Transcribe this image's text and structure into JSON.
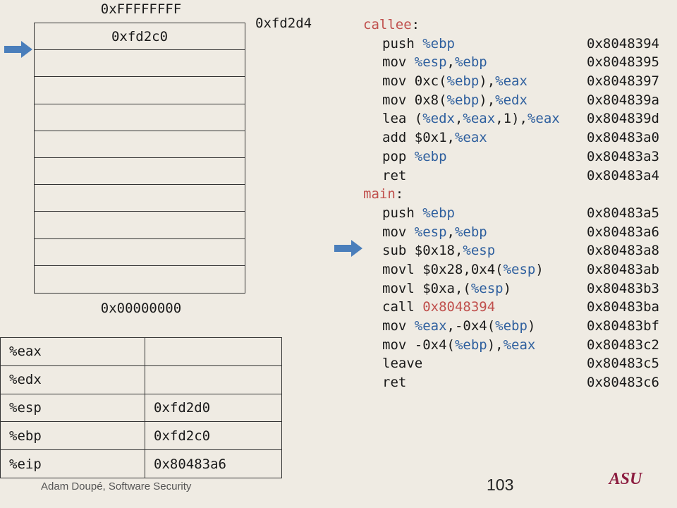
{
  "stack": {
    "top_address": "0xFFFFFFFF",
    "bottom_address": "0x00000000",
    "sp_annotation": "0xfd2d4",
    "slots": [
      "0xfd2c0",
      "",
      "",
      "",
      "",
      "",
      "",
      "",
      "",
      ""
    ]
  },
  "registers": [
    {
      "name": "%eax",
      "value": ""
    },
    {
      "name": "%edx",
      "value": ""
    },
    {
      "name": "%esp",
      "value": "0xfd2d0"
    },
    {
      "name": "%ebp",
      "value": "0xfd2c0"
    },
    {
      "name": "%eip",
      "value": "0x80483a6"
    }
  ],
  "code": {
    "callee_label": "callee",
    "main_label": "main",
    "colon": ":",
    "callee_lines": [
      {
        "parts": [
          {
            "t": "push ",
            "c": "op"
          },
          {
            "t": "%ebp",
            "c": "reg"
          }
        ],
        "addr": "0x8048394"
      },
      {
        "parts": [
          {
            "t": "mov ",
            "c": "op"
          },
          {
            "t": "%esp",
            "c": "reg"
          },
          {
            "t": ",",
            "c": "op"
          },
          {
            "t": "%ebp",
            "c": "reg"
          }
        ],
        "addr": "0x8048395"
      },
      {
        "parts": [
          {
            "t": "mov 0xc(",
            "c": "op"
          },
          {
            "t": "%ebp",
            "c": "reg"
          },
          {
            "t": "),",
            "c": "op"
          },
          {
            "t": "%eax",
            "c": "reg"
          }
        ],
        "addr": "0x8048397"
      },
      {
        "parts": [
          {
            "t": "mov 0x8(",
            "c": "op"
          },
          {
            "t": "%ebp",
            "c": "reg"
          },
          {
            "t": "),",
            "c": "op"
          },
          {
            "t": "%edx",
            "c": "reg"
          }
        ],
        "addr": "0x804839a"
      },
      {
        "parts": [
          {
            "t": "lea (",
            "c": "op"
          },
          {
            "t": "%edx",
            "c": "reg"
          },
          {
            "t": ",",
            "c": "op"
          },
          {
            "t": "%eax",
            "c": "reg"
          },
          {
            "t": ",1),",
            "c": "op"
          },
          {
            "t": "%eax",
            "c": "reg"
          }
        ],
        "addr": "0x804839d"
      },
      {
        "parts": [
          {
            "t": "add $0x1,",
            "c": "op"
          },
          {
            "t": "%eax",
            "c": "reg"
          }
        ],
        "addr": "0x80483a0"
      },
      {
        "parts": [
          {
            "t": "pop ",
            "c": "op"
          },
          {
            "t": "%ebp",
            "c": "reg"
          }
        ],
        "addr": "0x80483a3"
      },
      {
        "parts": [
          {
            "t": "ret",
            "c": "op"
          }
        ],
        "addr": "0x80483a4"
      }
    ],
    "main_lines": [
      {
        "parts": [
          {
            "t": "push ",
            "c": "op"
          },
          {
            "t": "%ebp",
            "c": "reg"
          }
        ],
        "addr": "0x80483a5"
      },
      {
        "parts": [
          {
            "t": "mov ",
            "c": "op"
          },
          {
            "t": "%esp",
            "c": "reg"
          },
          {
            "t": ",",
            "c": "op"
          },
          {
            "t": "%ebp",
            "c": "reg"
          }
        ],
        "addr": "0x80483a6"
      },
      {
        "parts": [
          {
            "t": "sub $0x18,",
            "c": "op"
          },
          {
            "t": "%esp",
            "c": "reg"
          }
        ],
        "addr": "0x80483a8"
      },
      {
        "parts": [
          {
            "t": "movl $0x28,0x4(",
            "c": "op"
          },
          {
            "t": "%esp",
            "c": "reg"
          },
          {
            "t": ")",
            "c": "op"
          }
        ],
        "addr": "0x80483ab"
      },
      {
        "parts": [
          {
            "t": "movl $0xa,(",
            "c": "op"
          },
          {
            "t": "%esp",
            "c": "reg"
          },
          {
            "t": ")",
            "c": "op"
          }
        ],
        "addr": "0x80483b3"
      },
      {
        "parts": [
          {
            "t": "call ",
            "c": "op"
          },
          {
            "t": "0x8048394",
            "c": "tgt"
          }
        ],
        "addr": "0x80483ba"
      },
      {
        "parts": [
          {
            "t": "mov ",
            "c": "op"
          },
          {
            "t": "%eax",
            "c": "reg"
          },
          {
            "t": ",-0x4(",
            "c": "op"
          },
          {
            "t": "%ebp",
            "c": "reg"
          },
          {
            "t": ")",
            "c": "op"
          }
        ],
        "addr": "0x80483bf"
      },
      {
        "parts": [
          {
            "t": "mov -0x4(",
            "c": "op"
          },
          {
            "t": "%ebp",
            "c": "reg"
          },
          {
            "t": "),",
            "c": "op"
          },
          {
            "t": "%eax",
            "c": "reg"
          }
        ],
        "addr": "0x80483c2"
      },
      {
        "parts": [
          {
            "t": "leave",
            "c": "op"
          }
        ],
        "addr": "0x80483c5"
      },
      {
        "parts": [
          {
            "t": "ret",
            "c": "op"
          }
        ],
        "addr": "0x80483c6"
      }
    ]
  },
  "footer": {
    "author": "Adam Doupé, Software Security",
    "page_number": "103",
    "logo_text": "ASU"
  },
  "colors": {
    "label": "#c0504d",
    "register": "#2e5f9e",
    "arrow": "#4a7ebb",
    "logo": "#8c1d40"
  },
  "icons": {
    "stack_pointer": "right-arrow-icon",
    "instruction_pointer": "right-arrow-icon"
  }
}
